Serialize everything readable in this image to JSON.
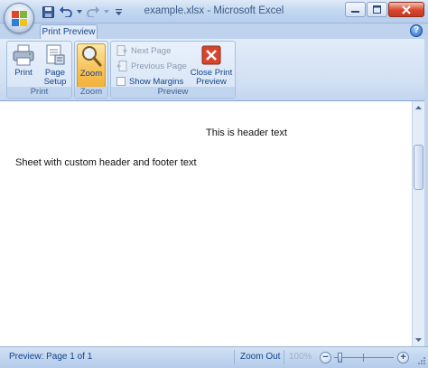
{
  "window": {
    "title": "example.xlsx - Microsoft Excel"
  },
  "quick_access": {
    "icons": [
      "save-icon",
      "undo-icon",
      "undo-dropdown-icon",
      "redo-icon",
      "redo-dropdown-icon",
      "customize-qat-icon"
    ]
  },
  "ribbon": {
    "tabs": [
      {
        "label": "Print Preview",
        "active": true
      }
    ],
    "groups": {
      "print": {
        "label": "Print",
        "buttons": [
          {
            "label": "Print",
            "icon": "printer-icon"
          },
          {
            "label": "Page Setup",
            "label_line1": "Page",
            "label_line2": "Setup",
            "icon": "page-setup-icon"
          }
        ]
      },
      "zoom": {
        "label": "Zoom",
        "buttons": [
          {
            "label": "Zoom",
            "icon": "magnifier-icon",
            "active": true
          }
        ]
      },
      "preview": {
        "label": "Preview",
        "next_page": {
          "label": "Next Page",
          "enabled": false
        },
        "previous_page": {
          "label": "Previous Page",
          "enabled": false
        },
        "show_margins": {
          "label": "Show Margins",
          "checked": false
        },
        "close": {
          "label": "Close Print Preview",
          "label_line1": "Close Print",
          "label_line2": "Preview",
          "icon": "close-preview-icon"
        }
      }
    }
  },
  "document": {
    "header_text": "This is header text",
    "body_text": "Sheet with custom header and footer text"
  },
  "statusbar": {
    "page_info": "Preview: Page 1 of 1",
    "zoom_out_label": "Zoom Out",
    "zoom_percent": "100%"
  },
  "colors": {
    "ribbon_blue": "#d1e0f3",
    "text_blue": "#15428b",
    "active_orange": "#f8c661",
    "close_red": "#d9442c"
  }
}
